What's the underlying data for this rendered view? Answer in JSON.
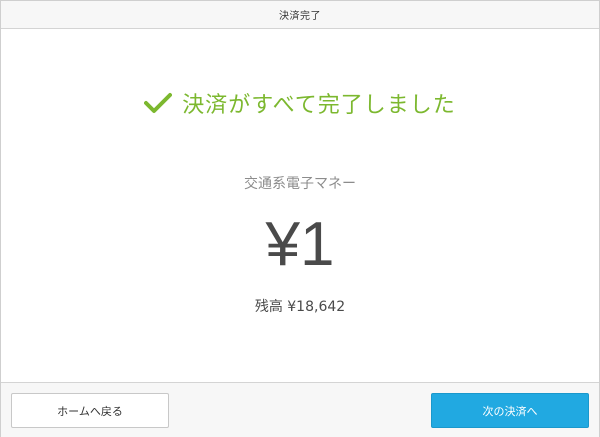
{
  "header": {
    "title": "決済完了"
  },
  "status": {
    "icon": "check-icon",
    "message": "決済がすべて完了しました",
    "color": "#7cb82f"
  },
  "payment": {
    "method": "交通系電子マネー",
    "amount": "¥1",
    "balance": "残高 ¥18,642"
  },
  "footer": {
    "home_label": "ホームへ戻る",
    "next_label": "次の決済へ",
    "accent_color": "#21a9e1"
  }
}
